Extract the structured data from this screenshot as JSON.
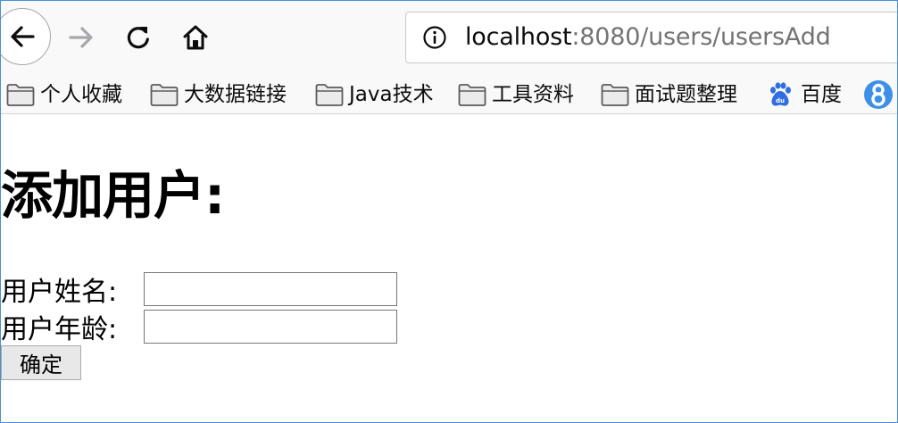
{
  "browser": {
    "url_host": "localhost",
    "url_rest": ":8080/users/usersAdd",
    "icons": {
      "back": "back-arrow-icon",
      "forward": "forward-arrow-icon",
      "reload": "reload-icon",
      "home": "home-icon",
      "info": "info-icon"
    }
  },
  "bookmarks": [
    {
      "label": "个人收藏",
      "icon": "folder-icon"
    },
    {
      "label": "大数据链接",
      "icon": "folder-icon"
    },
    {
      "label": "Java技术",
      "icon": "folder-icon"
    },
    {
      "label": "工具资料",
      "icon": "folder-icon"
    },
    {
      "label": "面试题整理",
      "icon": "folder-icon"
    },
    {
      "label": "百度",
      "icon": "baidu-paw-icon"
    }
  ],
  "page": {
    "title": "添加用户:",
    "form": {
      "name_label": "用户姓名:",
      "name_value": "",
      "age_label": "用户年龄:",
      "age_value": "",
      "submit_label": "确定"
    }
  },
  "colors": {
    "window_border": "#4a90d9",
    "chrome_bg": "#f9f9fa",
    "baidu_blue": "#2f6ee2",
    "badge_blue": "#3d8fe8"
  }
}
